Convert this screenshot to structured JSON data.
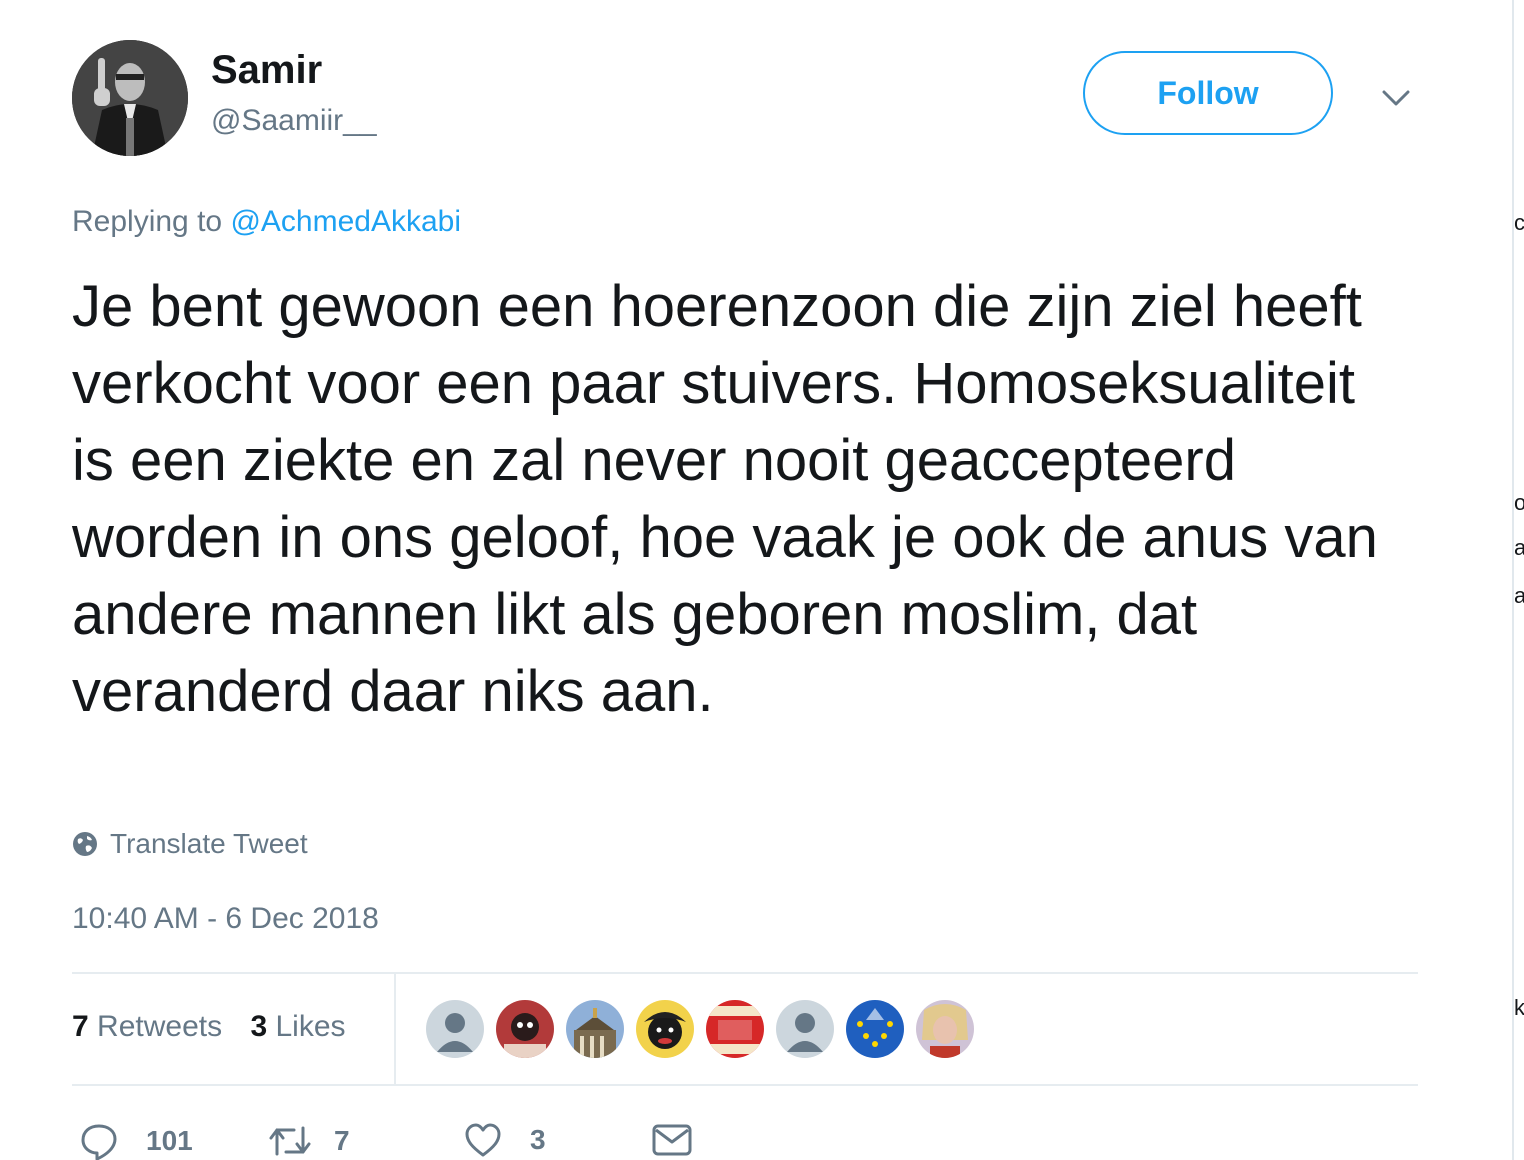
{
  "user": {
    "name": "Samir",
    "handle": "@Saamiir__"
  },
  "follow_label": "Follow",
  "reply": {
    "prefix": "Replying to",
    "mention": "@AchmedAkkabi"
  },
  "tweet_text": "Je bent gewoon een hoerenzoon die zijn ziel heeft verkocht voor een paar stuivers. Homoseksualiteit is een ziekte en zal never nooit geaccepteerd worden in ons geloof, hoe vaak je ook de anus van andere mannen likt als geboren moslim, dat veranderd daar niks aan.",
  "translate_label": "Translate Tweet",
  "timestamp": "10:40 AM - 6 Dec 2018",
  "stats": {
    "retweets_count": "7",
    "retweets_label": "Retweets",
    "likes_count": "3",
    "likes_label": "Likes"
  },
  "likers": [
    {
      "icon": "default-avatar-icon",
      "color": "#ccd6dd"
    },
    {
      "icon": "user-avatar",
      "color": "#b23a3a"
    },
    {
      "icon": "user-avatar",
      "color": "#7a6a4f"
    },
    {
      "icon": "user-avatar",
      "color": "#1a1a1a"
    },
    {
      "icon": "user-avatar",
      "color": "#d62828"
    },
    {
      "icon": "default-avatar-icon",
      "color": "#ccd6dd"
    },
    {
      "icon": "user-avatar",
      "color": "#1f5fbf"
    },
    {
      "icon": "user-avatar",
      "color": "#d9b8a8"
    }
  ],
  "actions": {
    "reply_count": "101",
    "retweet_count": "7",
    "like_count": "3"
  },
  "colors": {
    "accent": "#1da1f2",
    "muted": "#657786",
    "text": "#14171a"
  }
}
